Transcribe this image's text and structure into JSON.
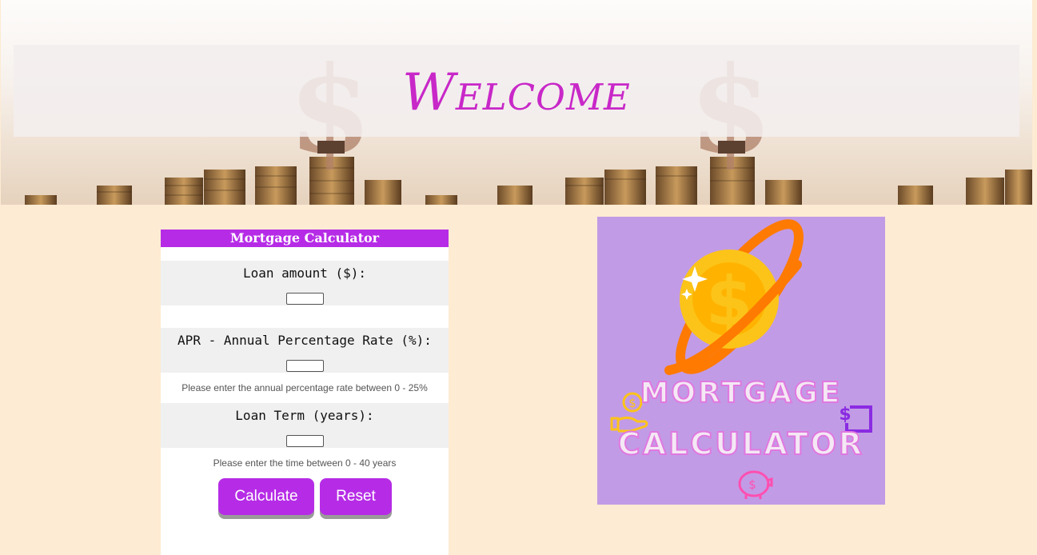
{
  "header": {
    "welcome": "Welcome"
  },
  "calculator": {
    "title": "Mortgage Calculator",
    "loan_amount": {
      "label": "Loan amount ($):",
      "value": ""
    },
    "apr": {
      "label": "APR - Annual Percentage Rate (%):",
      "value": "",
      "hint": "Please enter the annual percentage rate between 0 - 25%"
    },
    "term": {
      "label": "Loan Term (years):",
      "value": "",
      "hint": "Please enter the time between 0 - 40 years"
    },
    "calculate_label": "Calculate",
    "reset_label": "Reset"
  },
  "logo": {
    "line1": "MORTGAGE",
    "line2": "CALCULATOR",
    "coin_symbol": "$",
    "colors": {
      "background": "#c29be6",
      "coin": "#fcc419",
      "ring": "#ff7a00",
      "accent": "#8a2be2",
      "piggy": "#ff4fb0"
    }
  },
  "colors": {
    "accent": "#b62ce6",
    "page_bg": "#fdebd3",
    "welcome": "#c828c8"
  }
}
